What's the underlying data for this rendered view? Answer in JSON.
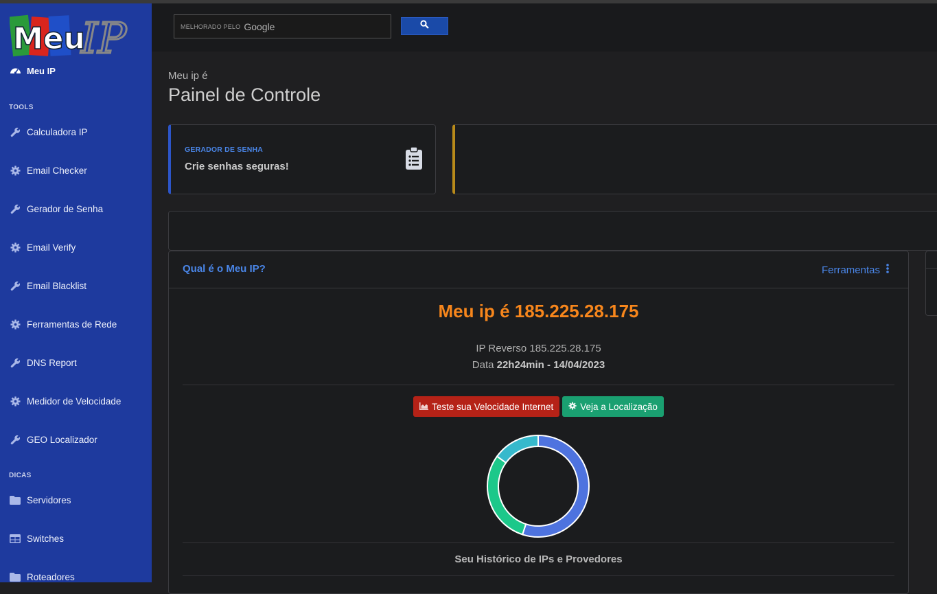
{
  "sidebar": {
    "logo_text_1": "Meu",
    "logo_text_2": "IP",
    "brand_label": "Meu IP",
    "section_tools": "TOOLS",
    "section_dicas": "DICAS",
    "tools": [
      {
        "label": "Calculadora IP",
        "icon": "wrench-icon"
      },
      {
        "label": "Email Checker",
        "icon": "gear-icon"
      },
      {
        "label": "Gerador de Senha",
        "icon": "wrench-icon"
      },
      {
        "label": "Email Verify",
        "icon": "gear-icon"
      },
      {
        "label": "Email Blacklist",
        "icon": "wrench-icon"
      },
      {
        "label": "Ferramentas de Rede",
        "icon": "gear-icon"
      },
      {
        "label": "DNS Report",
        "icon": "wrench-icon"
      },
      {
        "label": "Medidor de Velocidade",
        "icon": "gear-icon"
      },
      {
        "label": "GEO Localizador",
        "icon": "wrench-icon"
      }
    ],
    "dicas": [
      {
        "label": "Servidores",
        "icon": "folder-icon"
      },
      {
        "label": "Switches",
        "icon": "table-icon"
      },
      {
        "label": "Roteadores",
        "icon": "folder-icon"
      }
    ]
  },
  "search": {
    "prefix": "MELHORADO PELO",
    "brand": "Google"
  },
  "header": {
    "subtitle": "Meu ip é",
    "title": "Painel de Controle"
  },
  "card_password": {
    "label": "GERADOR DE SENHA",
    "text": "Crie senhas seguras!"
  },
  "panel": {
    "title": "Qual é o Meu IP?",
    "tools_link": "Ferramentas",
    "ip_line": "Meu ip é 185.225.28.175",
    "reverse_line": "IP Reverso 185.225.28.175",
    "date_prefix": "Data",
    "date_value": "22h24min - 14/04/2023",
    "btn_speed": "Teste sua Velocidade Internet",
    "btn_location": "Veja a Localização",
    "history_title": "Seu Histórico de IPs e Provedores"
  },
  "colors": {
    "sidebar": "#1e3a9e",
    "accent_blue": "#4a86e8",
    "ip_orange": "#f7861c",
    "btn_red": "#b52217",
    "btn_green": "#1aa071",
    "donut_blue": "#4e73df",
    "donut_green": "#1cc88a",
    "donut_cyan": "#36b9cc"
  },
  "chart_data": {
    "type": "pie",
    "categories": [
      "blue",
      "green",
      "cyan"
    ],
    "values": [
      55,
      30,
      15
    ]
  }
}
